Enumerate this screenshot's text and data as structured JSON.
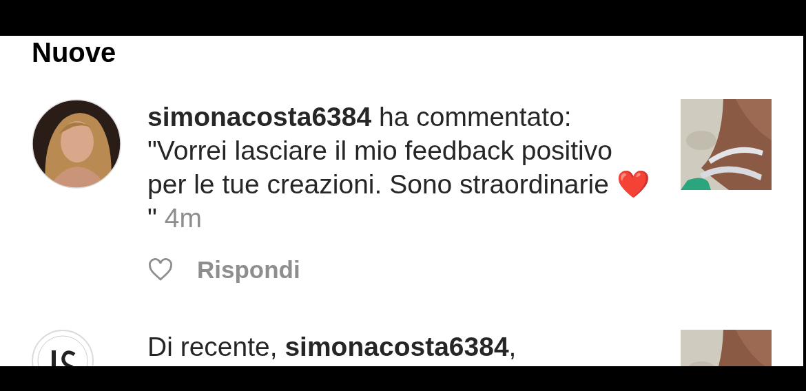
{
  "header": {
    "title": "Nuove"
  },
  "notifications": [
    {
      "kind": "comment",
      "text": "**simonacosta6384** ha commentato: \"Vorrei lasciare il mio feedback positivo per le tue creazioni. Sono straordinarie ",
      "emoji": "❤️",
      "text_end": " \"",
      "time": "4m",
      "liked": false,
      "reply": "Rispondi"
    },
    {
      "kind": "activity",
      "text": "Di recente, **simonacosta6384**,"
    }
  ]
}
